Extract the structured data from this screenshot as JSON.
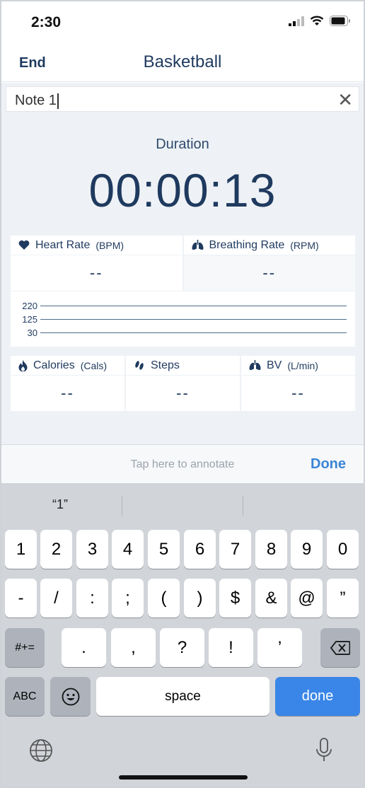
{
  "status_bar": {
    "time": "2:30"
  },
  "nav": {
    "end_label": "End",
    "title": "Basketball"
  },
  "note": {
    "value": "Note 1",
    "clear_glyph": "✕"
  },
  "duration": {
    "label": "Duration",
    "value": "00:00:13"
  },
  "metrics": {
    "heart_rate": {
      "label": "Heart Rate",
      "unit": "(BPM)",
      "value": "--",
      "icon": "heart-icon"
    },
    "breathing_rate": {
      "label": "Breathing Rate",
      "unit": "(RPM)",
      "value": "--",
      "icon": "lungs-icon"
    },
    "calories": {
      "label": "Calories",
      "unit": "(Cals)",
      "value": "--",
      "icon": "flame-icon"
    },
    "steps": {
      "label": "Steps",
      "unit": "",
      "value": "--",
      "icon": "footprints-icon"
    },
    "bv": {
      "label": "BV",
      "unit": "(L/min)",
      "value": "--",
      "icon": "lungs-icon"
    }
  },
  "hr_chart": {
    "levels": [
      "220",
      "125",
      "30"
    ]
  },
  "annotate": {
    "hint": "Tap here to annotate",
    "done_label": "Done"
  },
  "keyboard": {
    "suggestion": "“1”",
    "row1": [
      "1",
      "2",
      "3",
      "4",
      "5",
      "6",
      "7",
      "8",
      "9",
      "0"
    ],
    "row2": [
      "-",
      "/",
      ":",
      ";",
      "(",
      ")",
      "$",
      "&",
      "@",
      "”"
    ],
    "row3": [
      "#+=",
      ".",
      ",",
      "?",
      "!",
      "’"
    ],
    "abc_label": "ABC",
    "space_label": "space",
    "done_label": "done"
  },
  "colors": {
    "accent": "#3a86d6",
    "navy": "#1f3a5f",
    "background": "#eef2f6",
    "keyboard_bg": "#d1d4d9",
    "done_key": "#3a86e8"
  }
}
